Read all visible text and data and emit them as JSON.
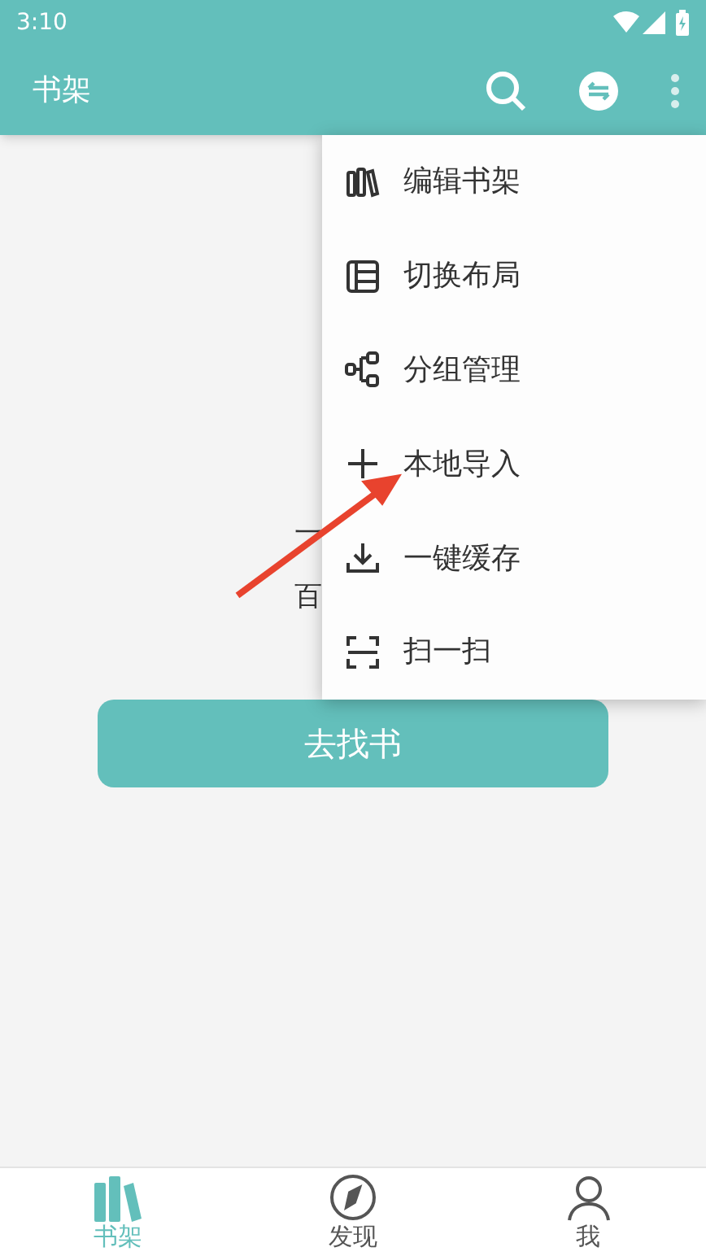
{
  "status_bar": {
    "time": "3:10"
  },
  "toolbar": {
    "title": "书架"
  },
  "empty_state": {
    "lines": [
      "一",
      "百"
    ],
    "button": "去找书"
  },
  "menu": {
    "items": [
      {
        "kind": "edit",
        "label": "编辑书架"
      },
      {
        "kind": "layout",
        "label": "切换布局"
      },
      {
        "kind": "group",
        "label": "分组管理"
      },
      {
        "kind": "add",
        "label": "本地导入"
      },
      {
        "kind": "download",
        "label": "一键缓存"
      },
      {
        "kind": "scan",
        "label": "扫一扫"
      }
    ]
  },
  "annotation_arrow": {
    "color": "#e8432e"
  },
  "bottom_nav": [
    {
      "kind": "shelf",
      "label": "书架",
      "selected": true
    },
    {
      "kind": "discover",
      "label": "发现",
      "selected": false
    },
    {
      "kind": "me",
      "label": "我",
      "selected": false
    }
  ]
}
